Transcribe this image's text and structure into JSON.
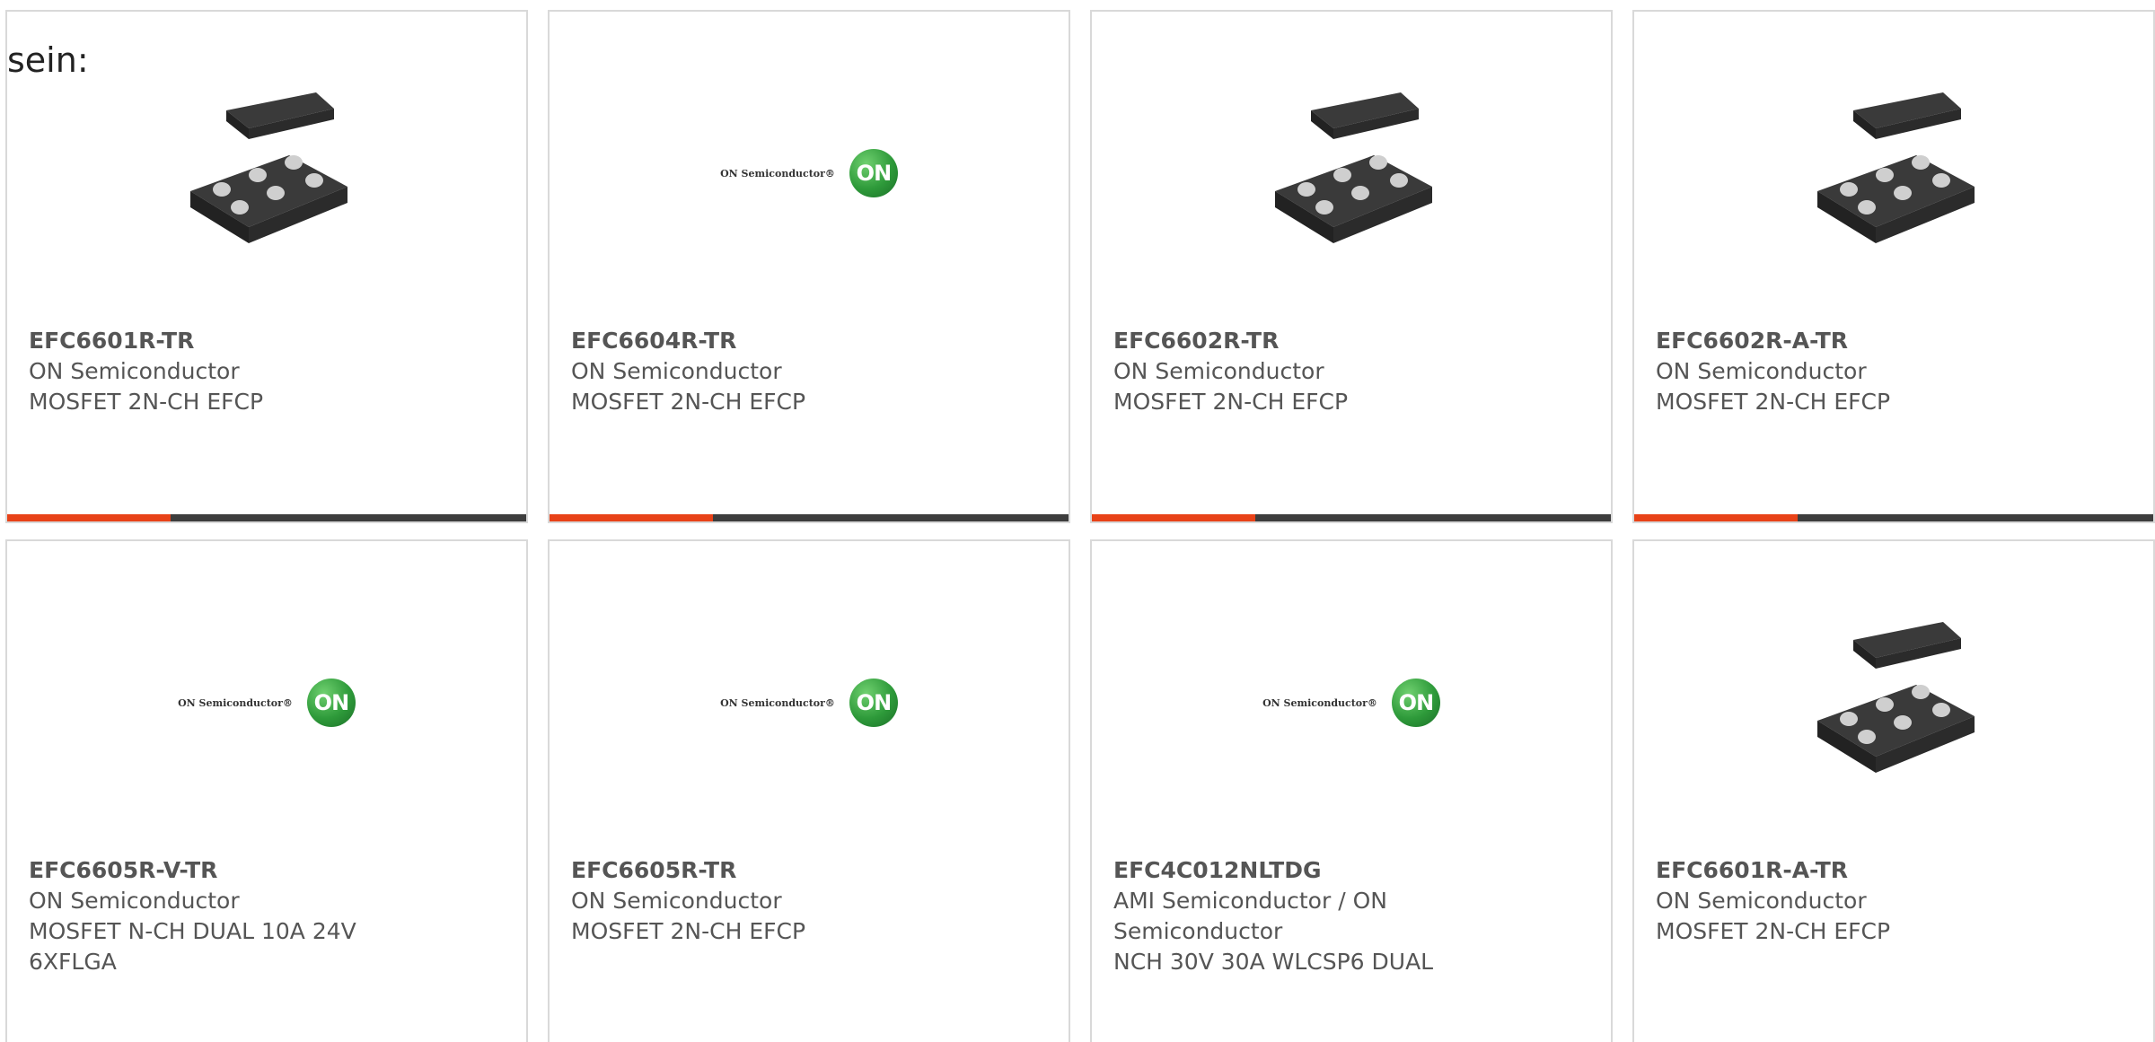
{
  "lead_text": "sein:",
  "products": [
    {
      "part_number": "EFC6601R-TR",
      "manufacturer": "ON Semiconductor",
      "description": "MOSFET 2N-CH EFCP",
      "image": "chip-package-image"
    },
    {
      "part_number": "EFC6604R-TR",
      "manufacturer": "ON Semiconductor",
      "description": "MOSFET 2N-CH EFCP",
      "image": "on-semiconductor-logo"
    },
    {
      "part_number": "EFC6602R-TR",
      "manufacturer": "ON Semiconductor",
      "description": "MOSFET 2N-CH EFCP",
      "image": "chip-package-image"
    },
    {
      "part_number": "EFC6602R-A-TR",
      "manufacturer": "ON Semiconductor",
      "description": "MOSFET 2N-CH EFCP",
      "image": "chip-package-image"
    },
    {
      "part_number": "EFC6605R-V-TR",
      "manufacturer": "ON Semiconductor",
      "description": "MOSFET N-CH DUAL 10A 24V 6XFLGA",
      "image": "on-semiconductor-logo"
    },
    {
      "part_number": "EFC6605R-TR",
      "manufacturer": "ON Semiconductor",
      "description": "MOSFET 2N-CH EFCP",
      "image": "on-semiconductor-logo"
    },
    {
      "part_number": "EFC4C012NLTDG",
      "manufacturer": "AMI Semiconductor / ON Semiconductor",
      "description": "NCH 30V 30A WLCSP6 DUAL",
      "image": "on-semiconductor-logo"
    },
    {
      "part_number": "EFC6601R-A-TR",
      "manufacturer": "ON Semiconductor",
      "description": "MOSFET 2N-CH EFCP",
      "image": "chip-package-image"
    }
  ],
  "logo": {
    "label": "ON Semiconductor®",
    "mark": "ON"
  },
  "colors": {
    "accent": "#e84218",
    "bar": "#3d3d3d",
    "border": "#d9d9d9",
    "text": "#555555"
  }
}
